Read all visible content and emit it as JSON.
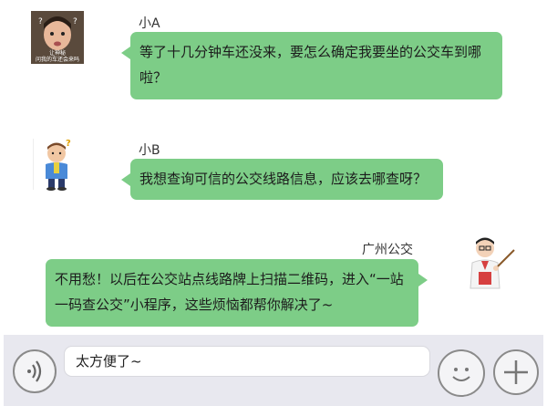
{
  "messages": [
    {
      "sender": "小A",
      "text": "等了十几分钟车还没来，要怎么确定我要坐的公交车到哪啦？",
      "avatar_caption": [
        "让神秘",
        "问我的车还会来吗"
      ]
    },
    {
      "sender": "小B",
      "text": "我想查询可信的公交线路信息，应该去哪查呀？"
    },
    {
      "sender": "广州公交",
      "text": "不用愁！以后在公交站点线路牌上扫描二维码，进入“一站一码查公交”小程序，这些烦恼都帮你解决了~"
    }
  ],
  "composer": {
    "input_value": "太方便了~",
    "voice_icon": "voice-wave-icon",
    "emoji_icon": "smile-face-icon",
    "add_icon": "plus-icon"
  },
  "colors": {
    "bubble": "#7dcd87",
    "composer_bg": "#e8e8ef"
  }
}
